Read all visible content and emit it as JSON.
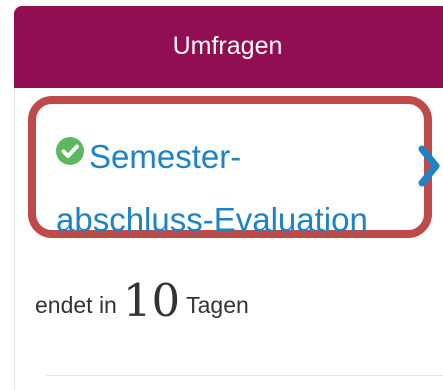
{
  "header": {
    "title": "Umfragen",
    "background_color": "#920e52"
  },
  "survey": {
    "status_icon": "check-circle-icon",
    "status_color": "#5cb85c",
    "title_line1": "Semester-",
    "title_line2": "abschluss-Evaluation",
    "title_color": "#1d83c6",
    "open_icon": "chevron-right-icon",
    "highlight_color": "#bf4a4a"
  },
  "deadline": {
    "prefix": "endet in",
    "number": "10",
    "suffix": "Tagen"
  }
}
